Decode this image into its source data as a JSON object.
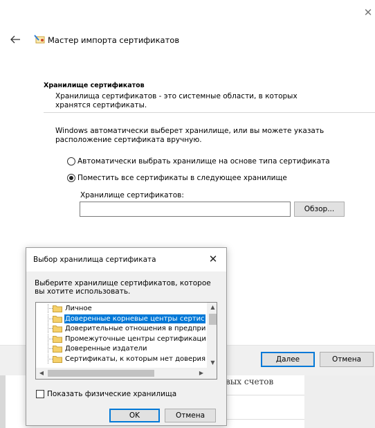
{
  "wizard": {
    "title": "Мастер импорта сертификатов",
    "section_title": "Хранилище сертификатов",
    "section_desc": "Хранилища сертификатов - это системные области, в которых хранятся сертификаты.",
    "intro": "Windows автоматически выберет хранилище, или вы можете указать расположение сертификата вручную.",
    "radio_auto": "Автоматически выбрать хранилище на основе типа сертификата",
    "radio_place": "Поместить все сертификаты в следующее хранилище",
    "store_label": "Хранилище сертификатов:",
    "store_value": "",
    "browse_label": "Обзор...",
    "next_label": "Далее",
    "cancel_label": "Отмена"
  },
  "background": {
    "partial_text": "вых счетов"
  },
  "dialog": {
    "title": "Выбор хранилища сертификата",
    "description": "Выберите хранилище сертификатов, которое вы хотите использовать.",
    "tree_items": [
      {
        "label": "Личное",
        "selected": false
      },
      {
        "label": "Доверенные корневые центры сертис",
        "selected": true
      },
      {
        "label": "Доверительные отношения в предпри",
        "selected": false
      },
      {
        "label": "Промежуточные центры сертификаци",
        "selected": false
      },
      {
        "label": "Доверенные издатели",
        "selected": false
      },
      {
        "label": "Сертификаты, к которым нет доверия",
        "selected": false
      }
    ],
    "show_physical_label": "Показать физические хранилища",
    "ok_label": "OK",
    "cancel_label": "Отмена"
  },
  "colors": {
    "accent": "#0078d7",
    "folder": "#f5d06a",
    "dialog_bg": "#f0f0f0"
  }
}
